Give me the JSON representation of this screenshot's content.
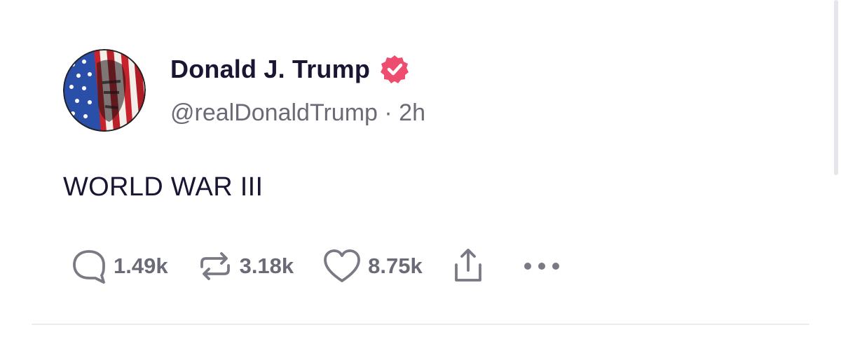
{
  "post": {
    "display_name": "Donald J. Trump",
    "handle": "@realDonaldTrump",
    "separator": " · ",
    "time": "2h",
    "text": "WORLD WAR III"
  },
  "actions": {
    "replies": "1.49k",
    "reposts": "3.18k",
    "likes": "8.75k"
  },
  "icons": {
    "verified": "verified-badge-icon",
    "reply": "comment-bubble-icon",
    "repost": "repost-arrows-icon",
    "like": "heart-icon",
    "share": "share-upload-icon",
    "more": "more-dots-icon"
  },
  "colors": {
    "accent": "#ee4d70",
    "text": "#1a1533",
    "muted": "#6b6b78"
  }
}
